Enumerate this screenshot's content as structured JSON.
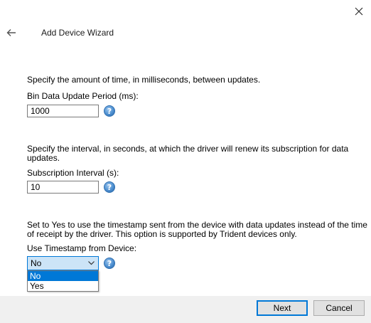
{
  "header": {
    "title": "Add Device Wizard"
  },
  "sections": [
    {
      "description": "Specify the amount of time, in milliseconds, between updates.",
      "label": "Bin Data Update Period (ms):",
      "value": "1000"
    },
    {
      "description_line1": "Specify the interval, in seconds, at which the driver will renew its subscription for data",
      "description_line2": "updates.",
      "label": "Subscription Interval (s):",
      "value": "10"
    },
    {
      "description_line1": "Set to Yes to use the timestamp sent from the device with data updates instead of the time",
      "description_line2": "of receipt by the driver. This option is supported by Trident devices only.",
      "label": "Use Timestamp from Device:",
      "selected": "No",
      "options": [
        "No",
        "Yes"
      ]
    }
  ],
  "help_glyph": "?",
  "footer": {
    "next_label": "Next",
    "cancel_label": "Cancel"
  },
  "icons": {
    "close": "close-icon",
    "back": "back-arrow-icon",
    "help": "help-icon",
    "dropdown": "chevron-down-icon"
  },
  "colors": {
    "accent": "#0078d7",
    "select_bg": "#cce4f7",
    "footer_bg": "#f0f0f0"
  }
}
